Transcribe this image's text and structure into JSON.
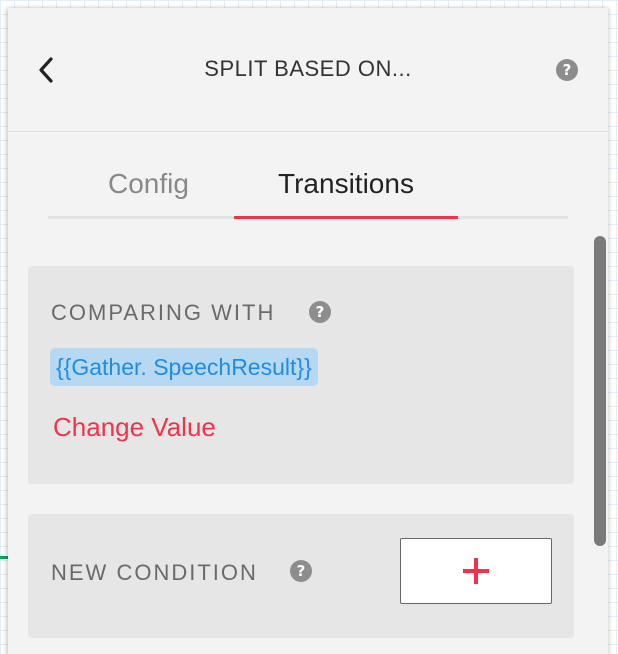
{
  "panel": {
    "title": "SPLIT BASED ON...",
    "back_icon": "chevron-left-icon",
    "help_icon": "question-circle-icon",
    "help_glyph": "?"
  },
  "tabs": [
    {
      "label": "Config",
      "active": false
    },
    {
      "label": "Transitions",
      "active": true
    }
  ],
  "comparing": {
    "label": "COMPARING WITH",
    "help_glyph": "?",
    "value": "{{Gather. SpeechResult}}",
    "change_label": "Change Value"
  },
  "new_condition": {
    "label": "NEW CONDITION",
    "help_glyph": "?",
    "add_icon": "plus-icon"
  },
  "colors": {
    "accent": "#f0334b",
    "link_blue": "#1f8ce6",
    "chip_bg": "#b6d8f2",
    "panel_bg": "#f3f3f3",
    "card_bg": "#e6e6e6"
  }
}
